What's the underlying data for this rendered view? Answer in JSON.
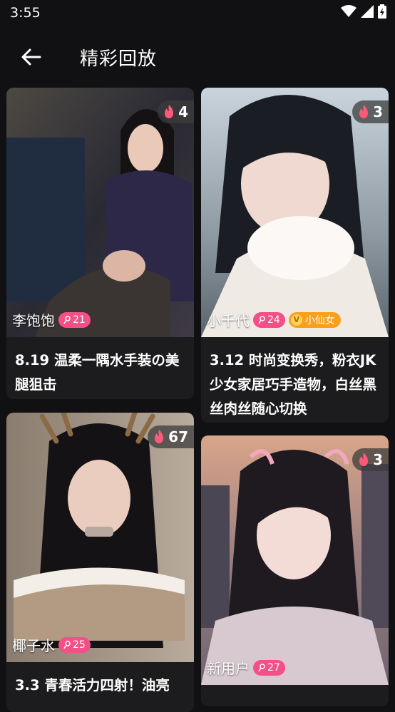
{
  "status": {
    "time": "3:55"
  },
  "header": {
    "title": "精彩回放"
  },
  "cards": [
    {
      "count": "4",
      "author": "李饱饱",
      "level": "21",
      "vip": "",
      "caption": "8.19 温柔一隅水手装の美腿狙击"
    },
    {
      "count": "3",
      "author": "小千代",
      "level": "24",
      "vip": "小仙女",
      "caption": "3.12 时尚变换秀，粉衣JK少女家居巧手造物，白丝黑丝肉丝随心切换"
    },
    {
      "count": "67",
      "author": "椰子水",
      "level": "25",
      "vip": "",
      "caption": "3.3 青春活力四射！油亮"
    },
    {
      "count": "3",
      "author": "新用户",
      "level": "27",
      "vip": "",
      "caption": ""
    }
  ],
  "colors": {
    "background": "#111113",
    "card": "#1c1c1e",
    "level_badge": "#f54f87",
    "vip_badge": "#f7a11a"
  }
}
